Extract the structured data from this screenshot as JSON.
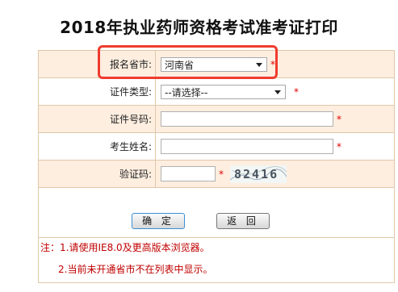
{
  "page": {
    "title": "2018年执业药师资格考试准考证打印"
  },
  "form": {
    "province": {
      "label": "报名省市:",
      "value": "河南省",
      "required_mark": "*"
    },
    "id_type": {
      "label": "证件类型:",
      "value": "--请选择--",
      "required_mark": "*"
    },
    "id_number": {
      "label": "证件号码:",
      "value": "",
      "required_mark": "*"
    },
    "name": {
      "label": "考生姓名:",
      "value": "",
      "required_mark": "*"
    },
    "captcha": {
      "label": "验证码:",
      "value": "",
      "required_mark": "*",
      "image_text": "82416"
    }
  },
  "buttons": {
    "confirm": "确 定",
    "back": "返 回"
  },
  "notes": {
    "line1": "注：1.请使用IE8.0及更高版本浏览器。",
    "line2": "2.当前未开通省市不在列表中显示。"
  },
  "colors": {
    "row_shade": "#fdeee0",
    "border": "#e0c8a8",
    "required": "#e00000",
    "highlight": "#ef3b2e",
    "note_text": "#c00000"
  }
}
